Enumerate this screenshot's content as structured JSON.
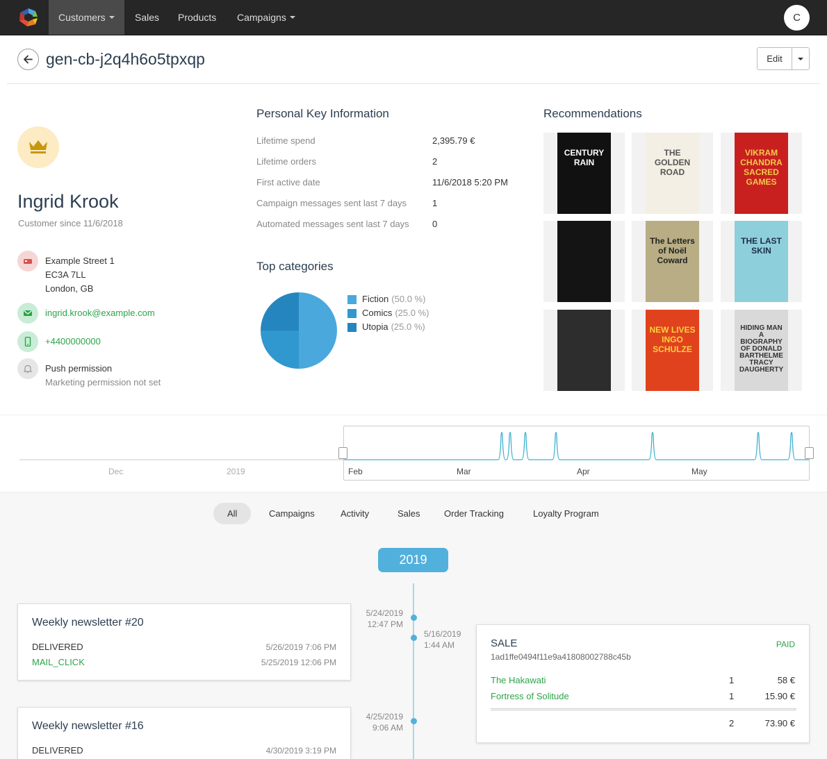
{
  "nav": {
    "items": [
      "Customers",
      "Sales",
      "Products",
      "Campaigns"
    ],
    "avatar_initial": "C"
  },
  "header": {
    "title": "gen-cb-j2q4h6o5tpxqp",
    "edit_label": "Edit"
  },
  "profile": {
    "name": "Ingrid Krook",
    "since": "Customer since 11/6/2018",
    "address_line1": "Example Street 1",
    "address_line2": "EC3A 7LL",
    "address_line3": "London, GB",
    "email": "ingrid.krook@example.com",
    "phone": "+4400000000",
    "push": "Push permission",
    "marketing": "Marketing permission not set"
  },
  "key_info": {
    "title": "Personal Key Information",
    "rows": [
      {
        "label": "Lifetime spend",
        "value": "2,395.79 €"
      },
      {
        "label": "Lifetime orders",
        "value": "2"
      },
      {
        "label": "First active date",
        "value": "11/6/2018 5:20 PM"
      },
      {
        "label": "Campaign messages sent last 7 days",
        "value": "1"
      },
      {
        "label": "Automated messages sent last 7 days",
        "value": "0"
      }
    ]
  },
  "top_categories": {
    "title": "Top categories",
    "items": [
      {
        "name": "Fiction",
        "pct": "(50.0 %)",
        "color": "#4aa8dc"
      },
      {
        "name": "Comics",
        "pct": "(25.0 %)",
        "color": "#3197cf"
      },
      {
        "name": "Utopia",
        "pct": "(25.0 %)",
        "color": "#2586bf"
      }
    ]
  },
  "chart_data": {
    "type": "pie",
    "categories": [
      "Fiction",
      "Comics",
      "Utopia"
    ],
    "values": [
      50.0,
      25.0,
      25.0
    ]
  },
  "recommendations": {
    "title": "Recommendations",
    "books": [
      {
        "title": "CENTURY RAIN",
        "bg": "#111111",
        "fg": "#ffffff"
      },
      {
        "title": "THE GOLDEN ROAD",
        "bg": "#f3efe4",
        "fg": "#555555"
      },
      {
        "title": "VIKRAM CHANDRA SACRED GAMES",
        "bg": "#c8201f",
        "fg": "#f2c94c"
      },
      {
        "title": "",
        "bg": "#141414",
        "fg": "#dddddd"
      },
      {
        "title": "The Letters of Noël Coward",
        "bg": "#b8ad84",
        "fg": "#222222"
      },
      {
        "title": "THE LAST SKIN",
        "bg": "#8ecfdc",
        "fg": "#1e2d4a"
      },
      {
        "title": "",
        "bg": "#2d2d2d",
        "fg": "#dddddd"
      },
      {
        "title": "NEW LIVES INGO SCHULZE",
        "bg": "#e0421e",
        "fg": "#f7d23b"
      },
      {
        "title": "HIDING MAN A BIOGRAPHY OF DONALD BARTHELME TRACY DAUGHERTY",
        "bg": "#d9d9d9",
        "fg": "#333333"
      }
    ]
  },
  "timeline_chart": {
    "axis": [
      "Dec",
      "2019",
      "Feb",
      "Mar",
      "Apr",
      "May"
    ]
  },
  "tabs": [
    "All",
    "Campaigns",
    "Activity",
    "Sales",
    "Order Tracking",
    "Loyalty Program"
  ],
  "year": "2019",
  "events": {
    "d1": {
      "date": "5/24/2019",
      "time": "12:47 PM"
    },
    "d2": {
      "date": "5/16/2019",
      "time": "1:44 AM"
    },
    "d3": {
      "date": "4/25/2019",
      "time": "9:06 AM"
    }
  },
  "newsletter1": {
    "title": "Weekly newsletter #20",
    "status1": "DELIVERED",
    "time1": "5/26/2019 7:06 PM",
    "status2": "MAIL_CLICK",
    "time2": "5/25/2019 12:06 PM"
  },
  "newsletter2": {
    "title": "Weekly newsletter #16",
    "status1": "DELIVERED",
    "time1": "4/30/2019 3:19 PM"
  },
  "sale": {
    "title": "SALE",
    "status": "PAID",
    "id": "1ad1ffe0494f11e9a41808002788c45b",
    "items": [
      {
        "name": "The Hakawati",
        "qty": "1",
        "price": "58 €"
      },
      {
        "name": "Fortress of Solitude",
        "qty": "1",
        "price": "15.90 €"
      }
    ],
    "total_qty": "2",
    "total_price": "73.90 €"
  }
}
